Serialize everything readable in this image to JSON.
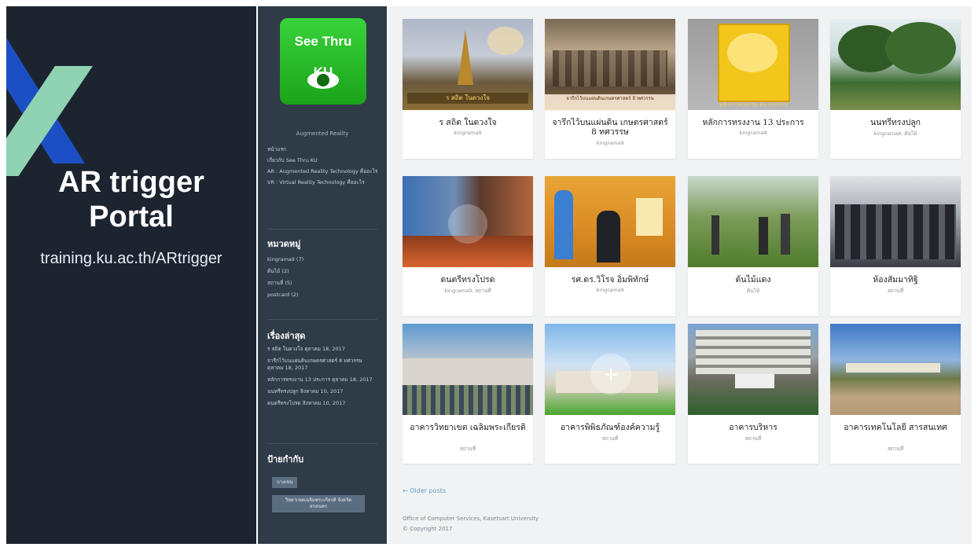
{
  "slide": {
    "title_line1": "AR trigger",
    "title_line2": "Portal",
    "url": "training.ku.ac.th/ARtrigger"
  },
  "sidebar": {
    "logo_line1": "See Thru",
    "logo_line2": "KU",
    "subtitle": "Augmented Reality",
    "nav": [
      "หน้าแรก",
      "เกี่ยวกับ See Thru KU",
      "AR : Augmented Reality Technology คืออะไร",
      "VR : Virtual Reality Technology คืออะไร"
    ],
    "categories_heading": "หมวดหมู่",
    "categories": [
      "kingrama9 (7)",
      "ต้นไม้ (2)",
      "สถานที่ (5)",
      "postcard (2)"
    ],
    "recent_heading": "เรื่องล่าสุด",
    "recent": [
      "ร สถิต ในดวงใจ ตุลาคม 18, 2017",
      "จารึกไว้บนแผ่นดินเกษตรศาสตร์ 8 ทศวรรษ ตุลาคม 18, 2017",
      "หลักการทรงงาน 13 ประการ ตุลาคม 18, 2017",
      "นนทรีทรงปลูก สิงหาคม 10, 2017",
      "ดนตรีทรงโปรด สิงหาคม 10, 2017"
    ],
    "tags_heading": "ป้ายกำกับ",
    "tags": [
      "บางเขน",
      "วิทยาเขตเฉลิมพระเกียรติ จังหวัดสกลนคร"
    ]
  },
  "posts": [
    {
      "title": "ร สถิต ในดวงใจ",
      "meta": "kingrama9"
    },
    {
      "title": "จารึกไว้บนแผ่นดิน เกษตรศาสตร์ 8 ทศวรรษ",
      "meta": "kingrama9"
    },
    {
      "title": "หลักการทรงงาน 13 ประการ",
      "meta": "kingrama9"
    },
    {
      "title": "นนทรีทรงปลูก",
      "meta": "kingrama9, ต้นไม้"
    },
    {
      "title": "ดนตรีทรงโปรด",
      "meta": "kingrama9, สถานที่"
    },
    {
      "title": "รศ.ดร.วิโรจ อิ่มพิทักษ์",
      "meta": "kingrama9"
    },
    {
      "title": "ต้นไม้แดง",
      "meta": "ต้นไม้"
    },
    {
      "title": "ห้องสัมมาทิฐิ",
      "meta": "สถานที่"
    },
    {
      "title": "อาคารวิทยาเขต เฉลิมพระเกียรติ",
      "meta": "สถานที่"
    },
    {
      "title": "อาคารพิพิธภัณฑ์องค์ความรู้",
      "meta": "สถานที่"
    },
    {
      "title": "อาคารบริหาร",
      "meta": "สถานที่"
    },
    {
      "title": "อาคารเทคโนโลยี สารสนเทศ",
      "meta": "สถานที่"
    }
  ],
  "image_captions": {
    "post1": "ร สถิต ในดวงใจ",
    "post2": "จารึกไว้บนแผ่นดินเกษตรศาสตร์ 8 ทศวรรษ",
    "post3": "หลักการทรงงาน ๑๓ ประการ"
  },
  "footer": {
    "older": "← Older posts",
    "line1": "Office of Computer Services, Kasetsart University",
    "line2": "© Copyright 2017"
  }
}
